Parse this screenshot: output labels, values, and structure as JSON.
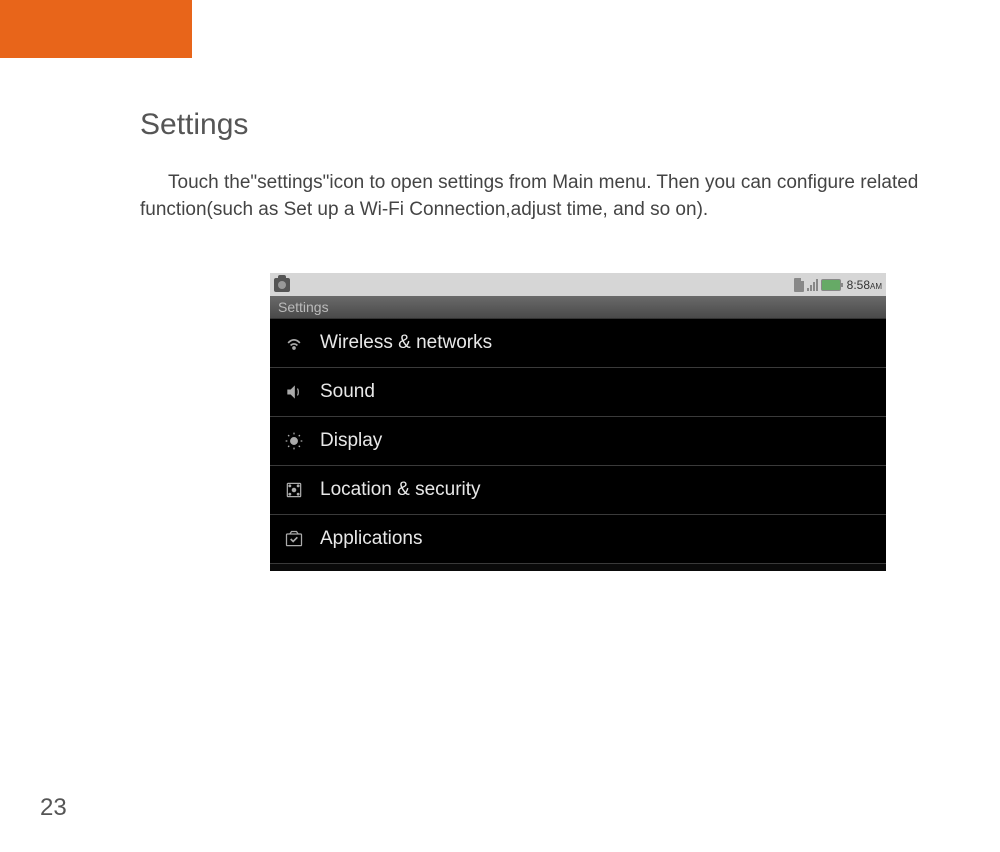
{
  "page": {
    "title": "Settings",
    "description": "Touch the\"settings\"icon to open settings from Main menu. Then you can configure related function(such as Set up a Wi-Fi Connection,adjust time, and so on).",
    "page_number": "23"
  },
  "status_bar": {
    "time": "8:58",
    "ampm": "AM"
  },
  "settings_screen": {
    "header": "Settings",
    "items": [
      {
        "label": "Wireless & networks",
        "icon": "wifi"
      },
      {
        "label": "Sound",
        "icon": "sound"
      },
      {
        "label": "Display",
        "icon": "display"
      },
      {
        "label": "Location & security",
        "icon": "location"
      },
      {
        "label": "Applications",
        "icon": "apps"
      }
    ]
  }
}
